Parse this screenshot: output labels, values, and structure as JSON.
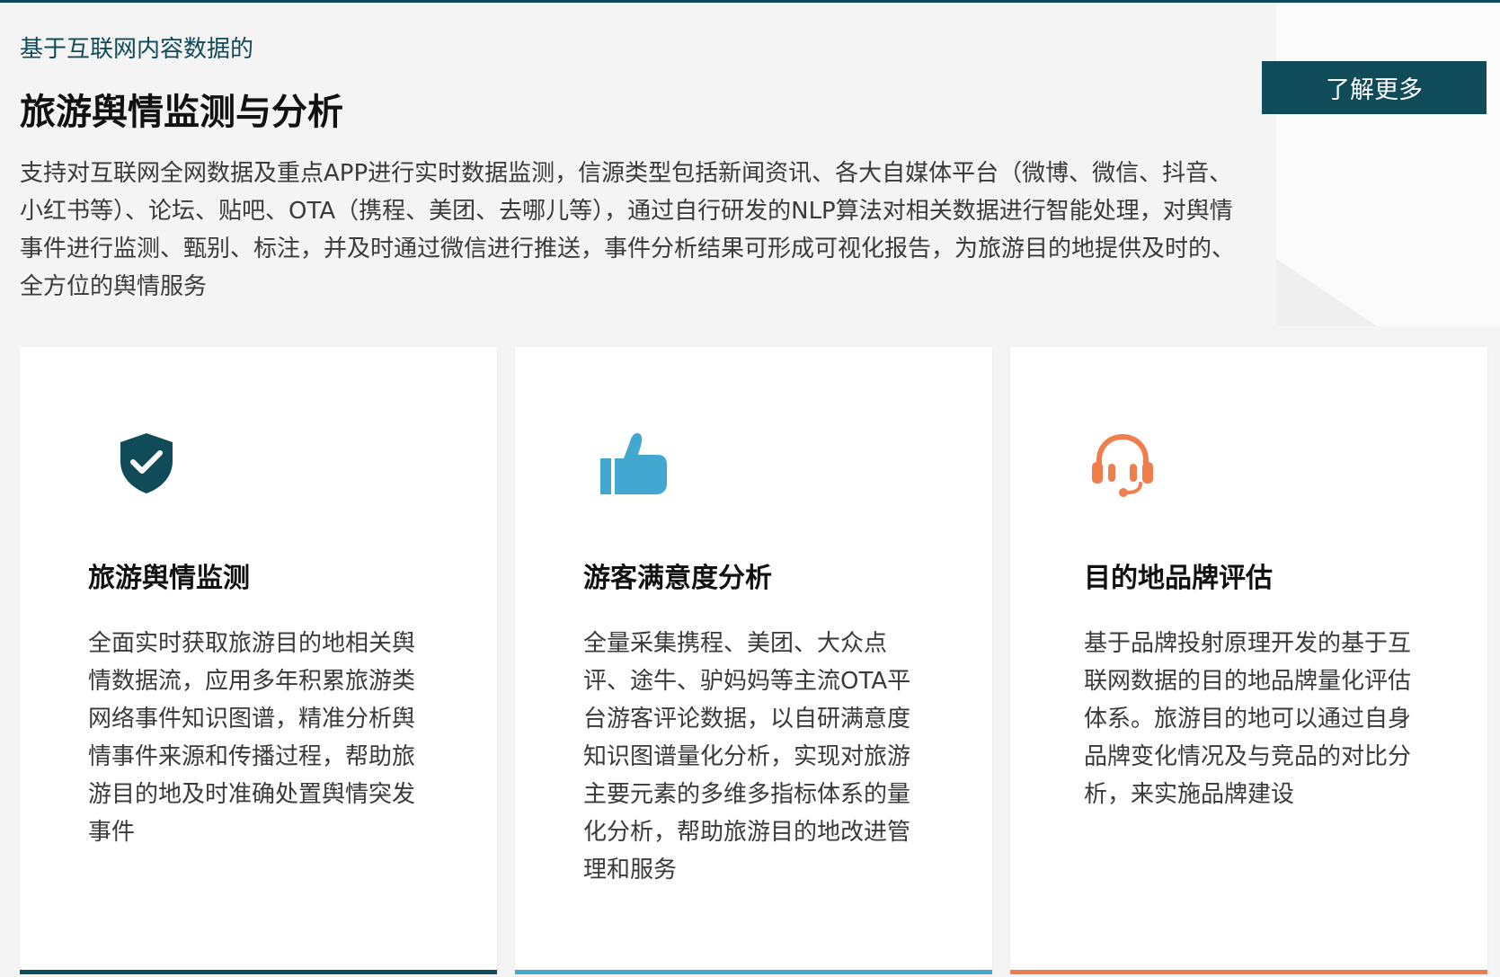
{
  "hero": {
    "eyebrow": "基于互联网内容数据的",
    "title": "旅游舆情监测与分析",
    "description": "支持对互联网全网数据及重点APP进行实时数据监测，信源类型包括新闻资讯、各大自媒体平台（微博、微信、抖音、小红书等）、论坛、贴吧、OTA（携程、美团、去哪儿等），通过自行研发的NLP算法对相关数据进行智能处理，对舆情事件进行监测、甄别、标注，并及时通过微信进行推送，事件分析结果可形成可视化报告，为旅游目的地提供及时的、全方位的舆情服务",
    "learn_more": "了解更多"
  },
  "colors": {
    "brand": "#104b59",
    "blue": "#42a8cf",
    "orange": "#f07d4c",
    "background": "#f4f4f4"
  },
  "cards": [
    {
      "icon": "shield-check-icon",
      "title": "旅游舆情监测",
      "text": "全面实时获取旅游目的地相关舆情数据流，应用多年积累旅游类网络事件知识图谱，精准分析舆情事件来源和传播过程，帮助旅游目的地及时准确处置舆情突发事件",
      "accent": "#104b59"
    },
    {
      "icon": "thumbs-up-icon",
      "title": "游客满意度分析",
      "text": "全量采集携程、美团、大众点评、途牛、驴妈妈等主流OTA平台游客评论数据，以自研满意度知识图谱量化分析，实现对旅游主要元素的多维多指标体系的量化分析，帮助旅游目的地改进管理和服务",
      "accent": "#42a8cf"
    },
    {
      "icon": "headset-icon",
      "title": "目的地品牌评估",
      "text": "基于品牌投射原理开发的基于互联网数据的目的地品牌量化评估体系。旅游目的地可以通过自身品牌变化情况及与竞品的对比分析，来实施品牌建设",
      "accent": "#f07d4c"
    }
  ]
}
